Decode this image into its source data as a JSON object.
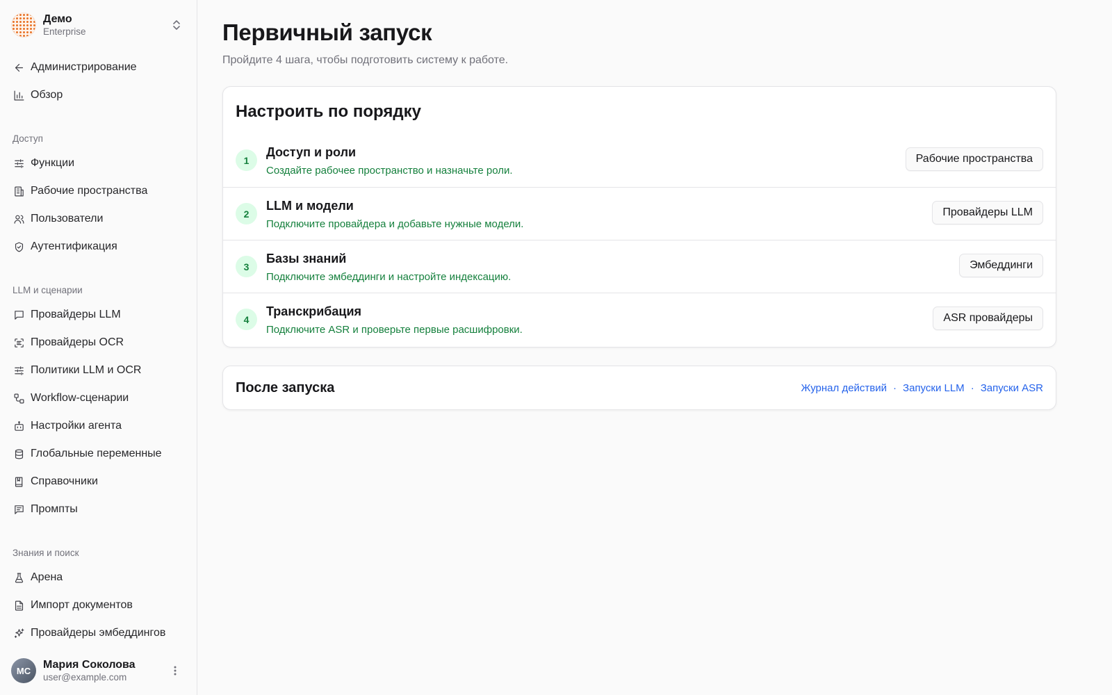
{
  "org": {
    "name": "Демо",
    "plan": "Enterprise"
  },
  "nav": {
    "back": "Администрирование",
    "overview": "Обзор",
    "sections": [
      {
        "label": "Доступ",
        "items": [
          "Функции",
          "Рабочие пространства",
          "Пользователи",
          "Аутентификация"
        ]
      },
      {
        "label": "LLM и сценарии",
        "items": [
          "Провайдеры LLM",
          "Провайдеры OCR",
          "Политики LLM и OCR",
          "Workflow-сценарии",
          "Настройки агента",
          "Глобальные переменные",
          "Справочники",
          "Промпты"
        ]
      },
      {
        "label": "Знания и поиск",
        "items": [
          "Арена",
          "Импорт документов",
          "Провайдеры эмбеддингов"
        ]
      }
    ]
  },
  "user": {
    "initials": "MC",
    "name": "Мария Соколова",
    "email": "user@example.com"
  },
  "page": {
    "title": "Первичный запуск",
    "subtitle": "Пройдите 4 шага, чтобы подготовить систему к работе."
  },
  "setup": {
    "title": "Настроить по порядку",
    "steps": [
      {
        "num": "1",
        "title": "Доступ и роли",
        "desc": "Создайте рабочее пространство и назначьте роли.",
        "button": "Рабочие пространства"
      },
      {
        "num": "2",
        "title": "LLM и модели",
        "desc": "Подключите провайдера и добавьте нужные модели.",
        "button": "Провайдеры LLM"
      },
      {
        "num": "3",
        "title": "Базы знаний",
        "desc": "Подключите эмбеддинги и настройте индексацию.",
        "button": "Эмбеддинги"
      },
      {
        "num": "4",
        "title": "Транскрибация",
        "desc": "Подключите ASR и проверьте первые расшифровки.",
        "button": "ASR провайдеры"
      }
    ]
  },
  "after": {
    "title": "После запуска",
    "links": [
      "Журнал действий",
      "Запуски LLM",
      "Запуски ASR"
    ],
    "separator": "·"
  },
  "colors": {
    "accent_green": "#15803d",
    "step_badge_bg": "#dcfce7",
    "link_blue": "#2563eb"
  }
}
